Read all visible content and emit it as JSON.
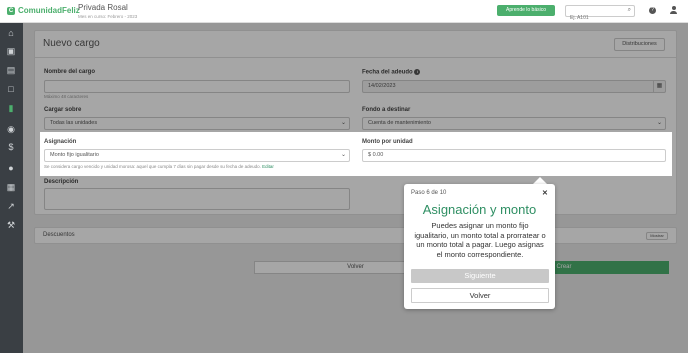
{
  "topbar": {
    "logo_text": "ComunidadFeliz",
    "community_name": "Privada Rosal",
    "community_month": "Mes en curso: Febrero - 2023",
    "learn_button": "Aprende lo básico",
    "search_placeholder": "Ej. A101"
  },
  "sidebar": {
    "items": [
      {
        "icon": "home-icon"
      },
      {
        "icon": "wallet-icon"
      },
      {
        "icon": "building-icon"
      },
      {
        "icon": "document-icon"
      },
      {
        "icon": "money-icon",
        "active": true
      },
      {
        "icon": "bank-icon"
      },
      {
        "icon": "dollar-icon"
      },
      {
        "icon": "people-icon"
      },
      {
        "icon": "calendar-icon"
      },
      {
        "icon": "chart-icon"
      },
      {
        "icon": "wrench-icon"
      }
    ]
  },
  "form": {
    "title": "Nuevo cargo",
    "distributions_button": "Distribuciones",
    "charge_name_label": "Nombre del cargo",
    "charge_name_hint": "Máximo 48 caracteres",
    "due_date_label": "Fecha del adeudo",
    "due_date_value": "14/02/2023",
    "charge_on_label": "Cargar sobre",
    "charge_on_value": "Todas las unidades",
    "fund_label": "Fondo a destinar",
    "fund_value": "Cuenta de mantenimiento",
    "assignment_label": "Asignación",
    "assignment_value": "Monto fijo igualitario",
    "assignment_hint": "Se considera cargo vencido y unidad morosa: aquel que cumpla 7 días sin pagar desde su fecha de adeudo.",
    "assignment_hint_link": "Editar",
    "amount_label": "Monto por unidad",
    "amount_value": "$ 0.00",
    "description_label": "Descripción",
    "discounts_label": "Descuentos",
    "discounts_button": "Mostrar",
    "back_button": "Volver",
    "create_button": "Crear"
  },
  "tooltip": {
    "step": "Paso 6 de 10",
    "title": "Asignación y monto",
    "body": "Puedes asignar un monto fijo igualitario, un monto total a prorratear o un monto total a pagar. Luego asignas el monto correspondiente.",
    "next_button": "Siguiente",
    "back_button": "Volver"
  },
  "colors": {
    "accent": "#4caf6d",
    "sidebar": "#3a3f44",
    "title_green": "#2f8f63"
  }
}
